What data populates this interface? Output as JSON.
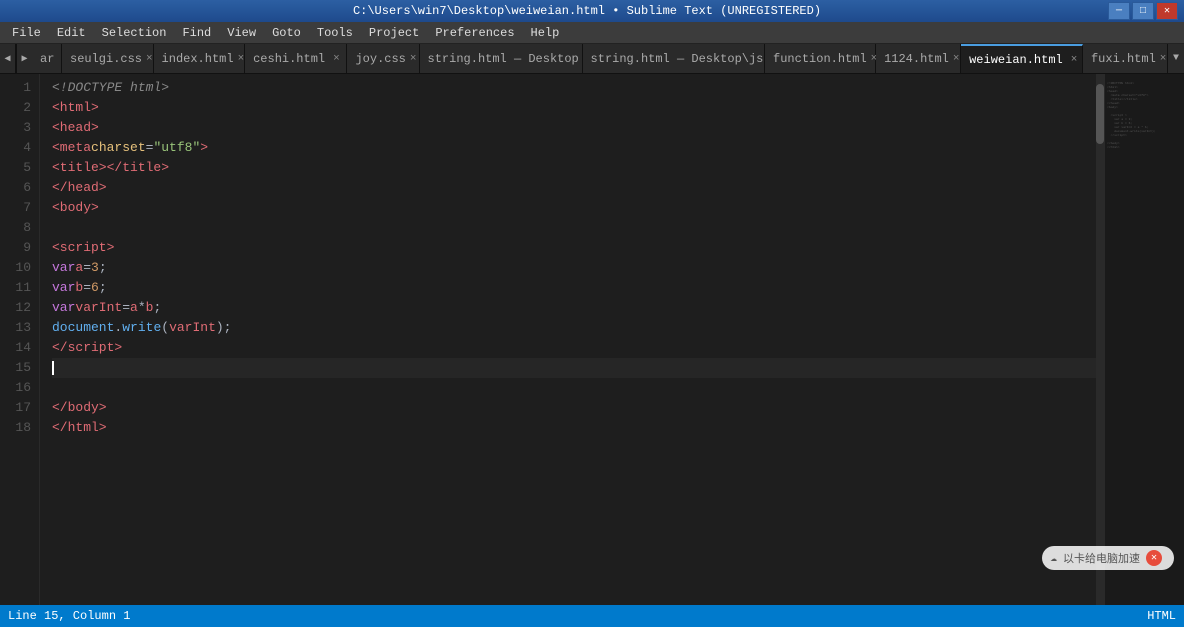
{
  "titleBar": {
    "text": "C:\\Users\\win7\\Desktop\\weiweian.html • Sublime Text (UNREGISTERED)",
    "minBtn": "─",
    "maxBtn": "□",
    "closeBtn": "✕"
  },
  "menuBar": {
    "items": [
      "File",
      "Edit",
      "Selection",
      "Find",
      "View",
      "Goto",
      "Tools",
      "Project",
      "Preferences",
      "Help"
    ]
  },
  "tabs": [
    {
      "label": "ar",
      "dot": false,
      "active": false,
      "close": false
    },
    {
      "label": "seulgi.css",
      "dot": false,
      "active": false,
      "close": true
    },
    {
      "label": "index.html",
      "dot": false,
      "active": false,
      "close": true
    },
    {
      "label": "ceshi.html",
      "dot": true,
      "dotColor": "#e5c07b",
      "active": false,
      "close": true
    },
    {
      "label": "joy.css",
      "dot": false,
      "active": false,
      "close": true
    },
    {
      "label": "string.html — Desktop",
      "dot": false,
      "active": false,
      "close": true
    },
    {
      "label": "string.html — Desktop\\js",
      "dot": false,
      "active": false,
      "close": true
    },
    {
      "label": "function.html",
      "dot": false,
      "active": false,
      "close": true
    },
    {
      "label": "1124.html",
      "dot": false,
      "active": false,
      "close": true
    },
    {
      "label": "weiweian.html",
      "dot": true,
      "dotColor": "#4a9de0",
      "active": true,
      "close": true
    },
    {
      "label": "fuxi.html",
      "dot": false,
      "active": false,
      "close": true
    }
  ],
  "statusBar": {
    "left": "Line 15, Column 1",
    "right": "HTML"
  },
  "watermark": {
    "text": "以卡给电脑加速"
  }
}
